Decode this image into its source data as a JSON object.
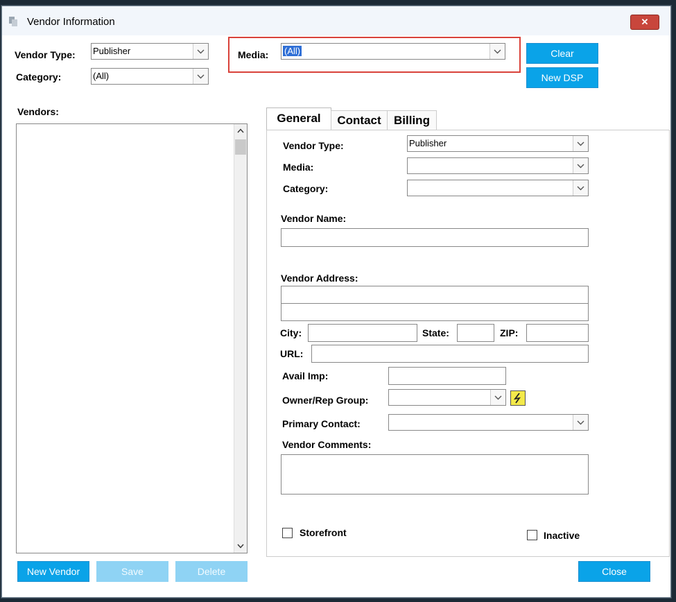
{
  "window": {
    "title": "Vendor Information",
    "close_glyph": "✕"
  },
  "filters": {
    "vendor_type_label": "Vendor Type:",
    "vendor_type_value": "Publisher",
    "category_label": "Category:",
    "category_value": "(All)",
    "media_label": "Media:",
    "media_value": "(All)"
  },
  "buttons": {
    "clear": "Clear",
    "new_dsp": "New DSP",
    "new_vendor": "New Vendor",
    "save": "Save",
    "delete": "Delete",
    "close": "Close"
  },
  "vendors": {
    "label": "Vendors:"
  },
  "tabs": [
    {
      "label": "General"
    },
    {
      "label": "Contact"
    },
    {
      "label": "Billing"
    }
  ],
  "general": {
    "vendor_type_label": "Vendor Type:",
    "vendor_type_value": "Publisher",
    "media_label": "Media:",
    "media_value": "",
    "category_label": "Category:",
    "category_value": "",
    "vendor_name_label": "Vendor Name:",
    "vendor_address_label": "Vendor Address:",
    "city_label": "City:",
    "state_label": "State:",
    "zip_label": "ZIP:",
    "url_label": "URL:",
    "avail_imp_label": "Avail Imp:",
    "owner_rep_group_label": "Owner/Rep Group:",
    "primary_contact_label": "Primary Contact:",
    "vendor_comments_label": "Vendor Comments:",
    "storefront_label": "Storefront",
    "inactive_label": "Inactive"
  },
  "colors": {
    "accent": "#0aa3e8",
    "highlight": "#d9423a",
    "lightning": "#e8e020"
  }
}
